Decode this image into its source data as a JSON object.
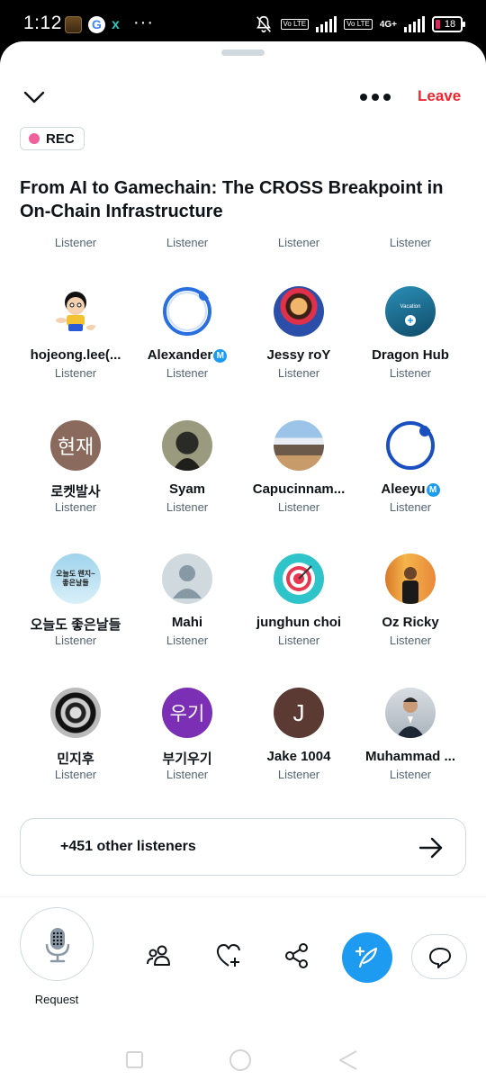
{
  "status_bar": {
    "time": "1:12",
    "more": "···",
    "x_glyph": "x",
    "lte1": "Vo LTE",
    "lte2": "Vo LTE",
    "net": "4G+",
    "battery": "18",
    "icons": [
      "clapperboard-icon",
      "google-icon",
      "x-icon",
      "mute-icon",
      "signal-icon",
      "battery-icon"
    ]
  },
  "header": {
    "leave_label": "Leave",
    "rec_label": "REC",
    "title": "From AI to Gamechain: The CROSS Breakpoint in On-Chain Infrastructure"
  },
  "top_row_labels": [
    "Listener",
    "Listener",
    "Listener",
    "Listener"
  ],
  "listeners": [
    {
      "name": "hojeong.lee(...",
      "role": "Listener",
      "badge": ""
    },
    {
      "name": "Alexander",
      "role": "Listener",
      "badge": "M"
    },
    {
      "name": "Jessy roY",
      "role": "Listener",
      "badge": ""
    },
    {
      "name": "Dragon Hub",
      "role": "Listener",
      "badge": ""
    },
    {
      "name": "로켓발사",
      "role": "Listener",
      "badge": "",
      "avatar_text": "현재"
    },
    {
      "name": "Syam",
      "role": "Listener",
      "badge": ""
    },
    {
      "name": "Capucinnam...",
      "role": "Listener",
      "badge": ""
    },
    {
      "name": "Aleeyu",
      "role": "Listener",
      "badge": "M"
    },
    {
      "name": "오늘도 좋은날들",
      "role": "Listener",
      "badge": "",
      "avatar_text": "오늘도 왠지~ 좋은날들"
    },
    {
      "name": "Mahi",
      "role": "Listener",
      "badge": ""
    },
    {
      "name": "junghun choi",
      "role": "Listener",
      "badge": ""
    },
    {
      "name": "Oz Ricky",
      "role": "Listener",
      "badge": ""
    },
    {
      "name": "민지후",
      "role": "Listener",
      "badge": ""
    },
    {
      "name": "부기우기",
      "role": "Listener",
      "badge": "",
      "avatar_text": "우기"
    },
    {
      "name": "Jake 1004",
      "role": "Listener",
      "badge": "",
      "avatar_text": "J"
    },
    {
      "name": "Muhammad ...",
      "role": "Listener",
      "badge": ""
    }
  ],
  "others": {
    "label": "+451 other listeners"
  },
  "controls": {
    "request_label": "Request"
  },
  "colors": {
    "accent": "#1d9bf0",
    "leave": "#f4212e",
    "rec_dot": "#f0609a"
  }
}
